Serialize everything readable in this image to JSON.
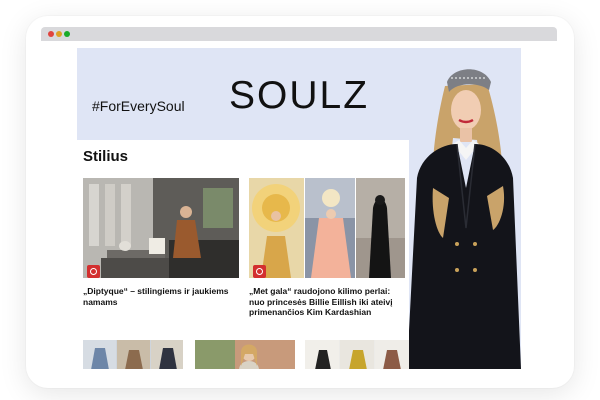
{
  "brand": {
    "logo": "SOULZ",
    "hashtag": "#ForEverySoul"
  },
  "section": {
    "title": "Stilius"
  },
  "articles": [
    {
      "headline": "„Diptyque“ – stilingiems ir jaukiems namams",
      "badge_icon": "camera-icon"
    },
    {
      "headline": "„Met gala“ raudojono kilimo perlai: nuo princesės Billie Eillish iki ateivį primenančios Kim Kardashian",
      "badge_icon": "camera-icon"
    }
  ],
  "colors": {
    "hero_bg": "#dfe5f5",
    "badge": "#d32f2f",
    "chrome": "#d9d9dc"
  }
}
